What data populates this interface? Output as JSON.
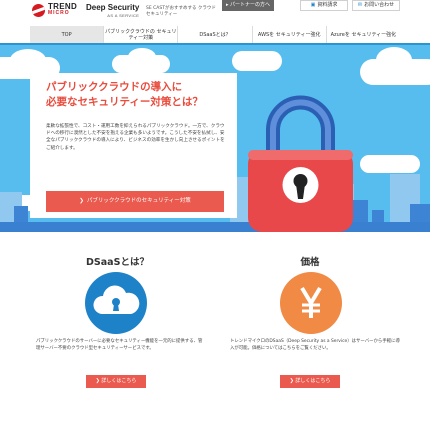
{
  "header": {
    "logo_brand_line1": "TREND",
    "logo_brand_line2": "MICRO",
    "product_name": "Deep Security",
    "product_sub": "AS A SERVICE",
    "tagline": "SE CASTがおすすめする クラウドセキュリティー",
    "partner_label": "パートナーの方へ",
    "docs_label": "資料請求",
    "contact_label": "お問い合わせ"
  },
  "nav": {
    "items": [
      {
        "label": "TOP"
      },
      {
        "label": "パブリッククラウドの セキュリティー対策"
      },
      {
        "label": "DSaaSとは？"
      },
      {
        "label": "AWSを セキュリティー強化"
      },
      {
        "label": "Azureを セキュリティー強化"
      }
    ]
  },
  "hero": {
    "title_line1": "パブリッククラウドの導入に",
    "title_line2": "必要なセキュリティー対策とは？",
    "body": "柔軟な拡張性で、コスト・運用工数を抑えられるパブリッククラウド。一方で、クラウドへの移行に漠然とした不安を抱える企業も多いようです。こうした不安を払拭し、安全なパブリッククラウドの導入により、ビジネスの効率を生かし向上させるポイントをご紹介します。",
    "cta_label": "パブリッククラウドのセキュリティー対策",
    "colors": {
      "sky": "#56bdee",
      "accent": "#ea5a4e",
      "lock": "#e8484a"
    }
  },
  "dsaas": {
    "title": "DSaaSとは？",
    "icon": "cloud-keyhole-icon",
    "description": "パブリッククラウドのサーバーに必要なセキュリティー機能を一元的に提供する、管理サーバー不要のクラウド型セキュリティーサービスです。",
    "button_label": "詳しくはこちら"
  },
  "price": {
    "title": "価格",
    "icon": "yen-icon",
    "description": "トレンドマイクロのDSaaS（Deep Security as a Service）はサーバーから手軽に導入が可能。価格についてはこちらをご覧ください。",
    "button_label": "詳しくはこちら"
  }
}
